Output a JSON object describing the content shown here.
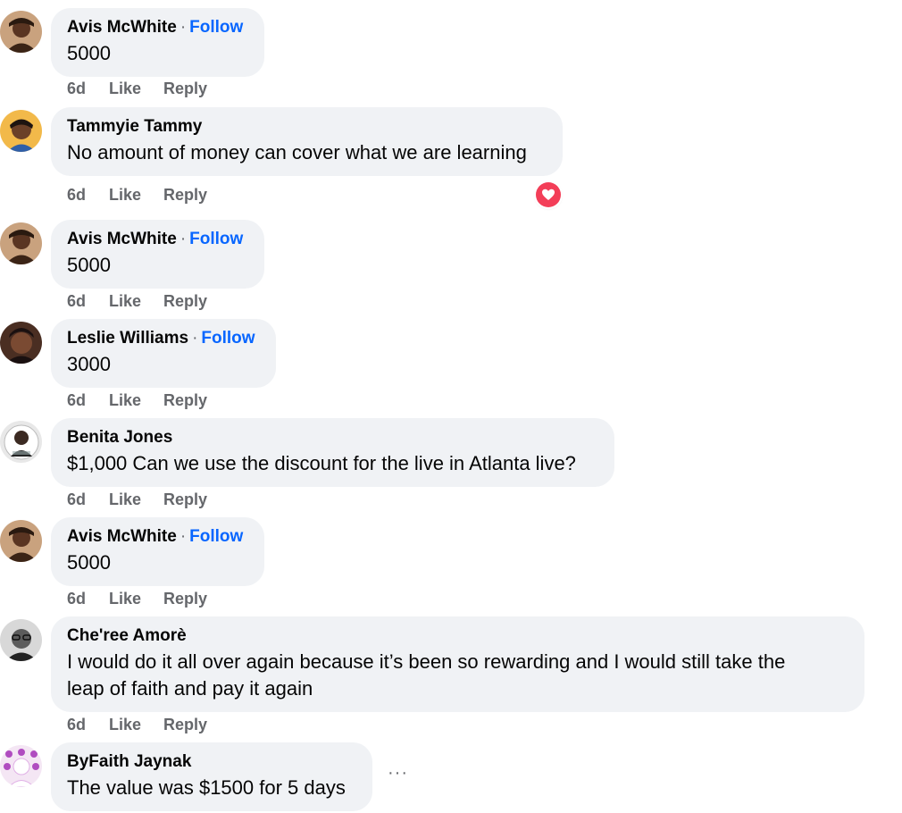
{
  "comments": [
    {
      "name": "Avis McWhite",
      "follow": "Follow",
      "text": "5000",
      "time": "6d",
      "like": "Like",
      "reply": "Reply"
    },
    {
      "name": "Tammyie Tammy",
      "follow": "",
      "text": "No amount of money can cover what we are learning",
      "time": "6d",
      "like": "Like",
      "reply": "Reply",
      "reaction": "heart-reaction-icon"
    },
    {
      "name": "Avis McWhite",
      "follow": "Follow",
      "text": "5000",
      "time": "6d",
      "like": "Like",
      "reply": "Reply"
    },
    {
      "name": "Leslie Williams",
      "follow": "Follow",
      "text": "3000",
      "time": "6d",
      "like": "Like",
      "reply": "Reply"
    },
    {
      "name": "Benita Jones",
      "follow": "",
      "text": "$1,000 Can we use the discount for the live in Atlanta live?",
      "time": "6d",
      "like": "Like",
      "reply": "Reply"
    },
    {
      "name": "Avis McWhite",
      "follow": "Follow",
      "text": "5000",
      "time": "6d",
      "like": "Like",
      "reply": "Reply"
    },
    {
      "name": "Che'ree Amorè",
      "follow": "",
      "text_line1": "I would do it all over again because it’s been so rewarding and I would still take the",
      "text_line2": "leap of faith and pay it again",
      "time": "6d",
      "like": "Like",
      "reply": "Reply"
    },
    {
      "name": "ByFaith Jaynak",
      "follow": "",
      "text": "The value was $1500 for 5 days",
      "more": "···"
    }
  ],
  "separator": "·",
  "colors": {
    "bubble": "#f0f2f5",
    "link": "#0866ff",
    "meta": "#65676b",
    "heart": "#f33e58"
  }
}
